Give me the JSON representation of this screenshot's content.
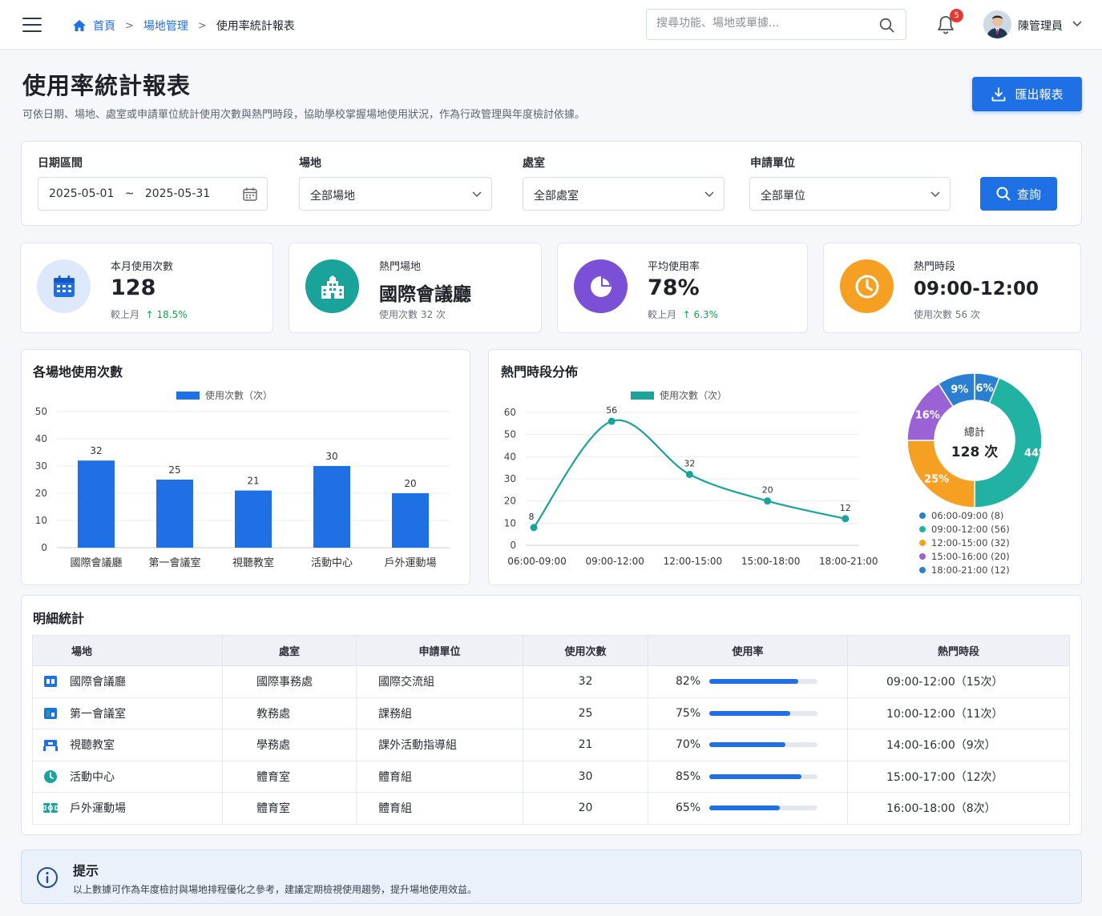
{
  "header": {
    "breadcrumb": {
      "home": "首頁",
      "section": "場地管理",
      "current": "使用率統計報表",
      "separator": ">"
    },
    "search_placeholder": "搜尋功能、場地或單據...",
    "notification_count": "5",
    "user_name": "陳管理員"
  },
  "page": {
    "title": "使用率統計報表",
    "description": "可依日期、場地、處室或申請單位統計使用次數與熱門時段，協助學校掌握場地使用狀況，作為行政管理與年度檢討依據。",
    "export_label": "匯出報表"
  },
  "filters": {
    "date_label": "日期區間",
    "date_start": "2025-05-01",
    "date_sep": "~",
    "date_end": "2025-05-31",
    "venue_label": "場地",
    "venue_value": "全部場地",
    "office_label": "處室",
    "office_value": "全部處室",
    "unit_label": "申請單位",
    "unit_value": "全部單位",
    "query_label": "查詢"
  },
  "kpis": [
    {
      "label": "本月使用次數",
      "value": "128",
      "sub": "較上月",
      "trend": "18.5%",
      "icon": "calendar-icon",
      "color": "#1f6fe5"
    },
    {
      "label": "熱門場地",
      "value": "國際會議廳",
      "sub": "使用次數  32 次",
      "icon": "building-icon",
      "color": "#1aa39a"
    },
    {
      "label": "平均使用率",
      "value": "78%",
      "sub": "較上月",
      "trend": "6.3%",
      "icon": "pie-icon",
      "color": "#7b4fd6"
    },
    {
      "label": "熱門時段",
      "value": "09:00-12:00",
      "sub": "使用次數  56 次",
      "icon": "clock-icon",
      "color": "#f5a023"
    }
  ],
  "bar_chart_title": "各場地使用次數",
  "line_chart_title": "熱門時段分佈",
  "donut": {
    "center_label": "總計",
    "center_value": "128 次"
  },
  "chart_data": [
    {
      "type": "bar",
      "legend": "使用次數（次）",
      "categories": [
        "國際會議廳",
        "第一會議室",
        "視聽教室",
        "活動中心",
        "戶外運動場"
      ],
      "values": [
        32,
        25,
        21,
        30,
        20
      ],
      "ylim": [
        0,
        50
      ],
      "yticks": [
        0,
        10,
        20,
        30,
        40,
        50
      ],
      "color": "#1f6fe5",
      "legend_position": "top"
    },
    {
      "type": "line",
      "legend": "使用次數（次）",
      "x": [
        "06:00-09:00",
        "09:00-12:00",
        "12:00-15:00",
        "15:00-18:00",
        "18:00-21:00"
      ],
      "values": [
        8,
        56,
        32,
        20,
        12
      ],
      "ylim": [
        0,
        60
      ],
      "yticks": [
        0,
        10,
        20,
        30,
        40,
        50,
        60
      ],
      "color": "#1aa39a",
      "legend_position": "top"
    },
    {
      "type": "pie",
      "slices": [
        {
          "label": "06:00-09:00 (8)",
          "pct": 6,
          "color": "#2b7fd1"
        },
        {
          "label": "09:00-12:00 (56)",
          "pct": 44,
          "color": "#22b2a4"
        },
        {
          "label": "12:00-15:00 (32)",
          "pct": 25,
          "color": "#f5a023"
        },
        {
          "label": "15:00-16:00 (20)",
          "pct": 16,
          "color": "#9b62d6"
        },
        {
          "label": "18:00-21:00 (12)",
          "pct": 9,
          "color": "#2b7fd1"
        }
      ]
    }
  ],
  "table": {
    "title": "明細統計",
    "headers": [
      "場地",
      "處室",
      "申請單位",
      "使用次數",
      "使用率",
      "熱門時段"
    ],
    "rows": [
      {
        "venue": "國際會議廳",
        "office": "國際事務處",
        "unit": "國際交流組",
        "count": "32",
        "rate": "82%",
        "rate_value": 0.82,
        "peak": "09:00-12:00（15次）",
        "icon": "meeting-room-icon",
        "icolor": "#1f6fe5"
      },
      {
        "venue": "第一會議室",
        "office": "教務處",
        "unit": "課務組",
        "count": "25",
        "rate": "75%",
        "rate_value": 0.75,
        "peak": "10:00-12:00（11次）",
        "icon": "office-icon",
        "icolor": "#1aa39a"
      },
      {
        "venue": "視聽教室",
        "office": "學務處",
        "unit": "課外活動指導組",
        "count": "21",
        "rate": "70%",
        "rate_value": 0.7,
        "peak": "14:00-16:00（9次）",
        "icon": "classroom-icon",
        "icolor": "#1f6fe5"
      },
      {
        "venue": "活動中心",
        "office": "體育室",
        "unit": "體育組",
        "count": "30",
        "rate": "85%",
        "rate_value": 0.85,
        "peak": "15:00-17:00（12次）",
        "icon": "activity-icon",
        "icolor": "#1aa39a"
      },
      {
        "venue": "戶外運動場",
        "office": "體育室",
        "unit": "體育組",
        "count": "20",
        "rate": "65%",
        "rate_value": 0.65,
        "peak": "16:00-18:00（8次）",
        "icon": "field-icon",
        "icolor": "#1aa39a"
      }
    ]
  },
  "tip": {
    "title": "提示",
    "text": "以上數據可作為年度檢討與場地排程優化之參考，建議定期檢視使用趨勢，提升場地使用效益。"
  }
}
